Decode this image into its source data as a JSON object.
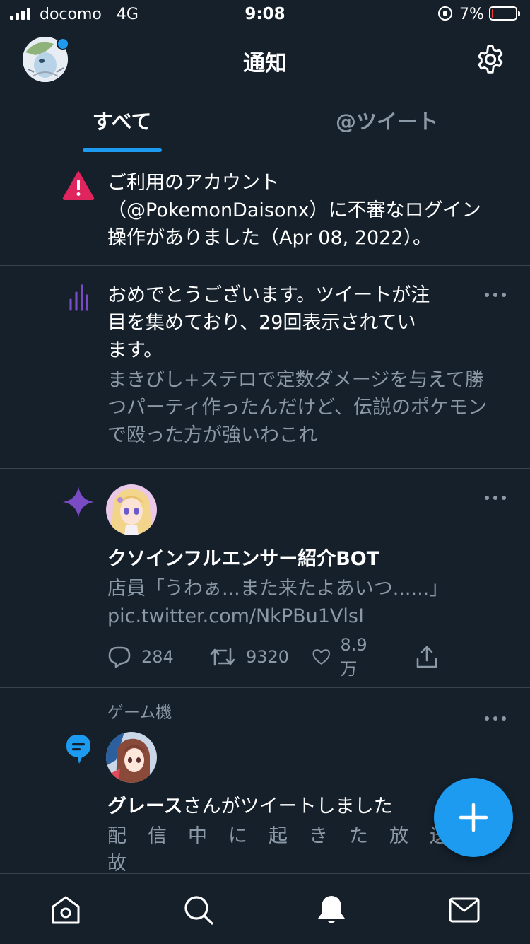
{
  "status_bar": {
    "carrier": "docomo",
    "network": "4G",
    "time": "9:08",
    "battery_pct": "7%",
    "battery_level": 0.07,
    "battery_color": "#ff3b30"
  },
  "header": {
    "title": "通知",
    "avatar_icon": "profile-avatar",
    "settings_icon": "gear-icon"
  },
  "tabs": [
    {
      "label": "すべて",
      "active": true
    },
    {
      "label": "@ツイート",
      "active": false
    }
  ],
  "notifications": [
    {
      "icon": "alert-icon",
      "lines": [
        "ご利用のアカウント",
        "（@PokemonDaisonx）に不審なログイン",
        "操作がありました（Apr 08, 2022）。"
      ]
    },
    {
      "icon": "analytics-icon",
      "lines": [
        "おめでとうございます。ツイートが注",
        "目を集めており、29回表示されてい",
        "ます。"
      ],
      "tweet_lines": [
        "まきびし+ステロで定数ダメージを与えて勝",
        "つパーティ作ったんだけど、伝説のポケモン",
        "で殴った方が強いわこれ"
      ]
    },
    {
      "icon": "sparkle-icon",
      "account_name": "クソインフルエンサー紹介BOT",
      "tweet_lines": [
        "店員「うわぁ...また来たよあいつ......」",
        "pic.twitter.com/NkPBu1VlsI"
      ],
      "stats": {
        "replies": "284",
        "retweets": "9320",
        "likes": "8.9万"
      }
    },
    {
      "icon": "tweet-bubble-icon",
      "topic": "ゲーム機",
      "user": "グレース",
      "action": "さんがツイートしました",
      "tweet_lines": [
        "配信中に起きた放送事",
        "故"
      ]
    }
  ],
  "fab_icon": "plus-icon",
  "bottom_nav": [
    "home-icon",
    "search-icon",
    "bell-icon",
    "mail-icon"
  ],
  "colors": {
    "background": "#15202b",
    "accent": "#1d9bf0",
    "alert": "#e0245e",
    "analytics": "#794bc4",
    "divider": "#38444d",
    "muted": "#8b98a5"
  }
}
